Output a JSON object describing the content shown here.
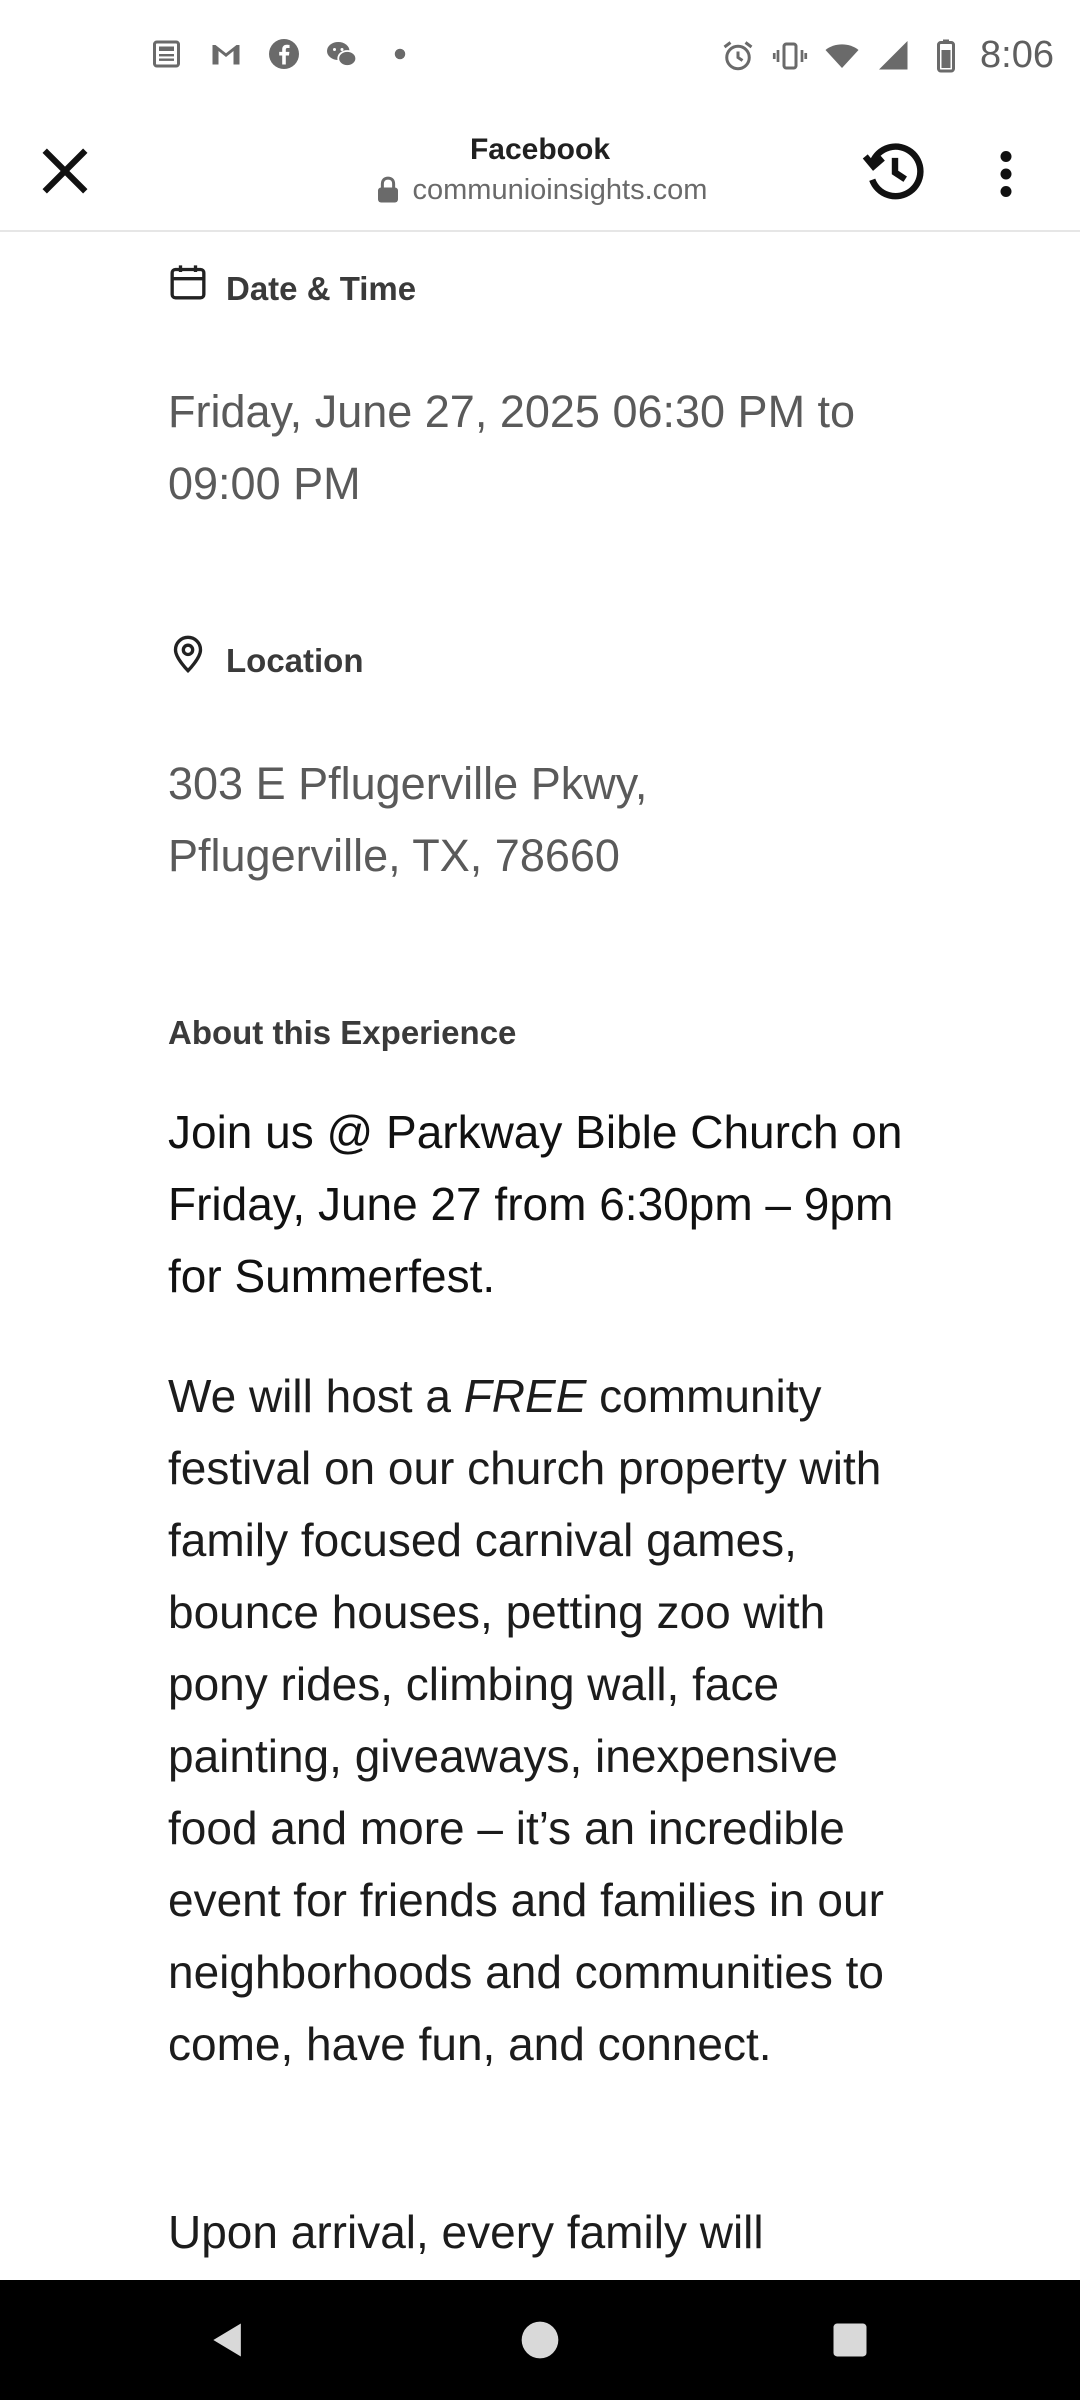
{
  "status_bar": {
    "time": "8:06",
    "left_icons": [
      "news-icon",
      "gmail-icon",
      "facebook-icon",
      "wechat-icon",
      "dot-icon"
    ],
    "right_icons": [
      "alarm-icon",
      "vibrate-icon",
      "wifi-icon",
      "signal-icon",
      "battery-icon"
    ]
  },
  "header": {
    "title": "Facebook",
    "url": "communioinsights.com"
  },
  "event": {
    "date_label": "Date & Time",
    "date_line1": "Friday, June 27, 2025 06:30 PM to",
    "date_line2": "09:00 PM",
    "location_label": "Location",
    "location_line1": "303 E Pflugerville Pkwy,",
    "location_line2": "Pflugerville, TX, 78660",
    "about_label": "About this Experience",
    "intro": "Join us @ Parkway Bible Church on Friday, June 27 from 6:30pm – 9pm for Summerfest.",
    "body_prefix": "We will host a ",
    "body_em": "FREE",
    "body_suffix": " community festival on our church property with family focused carnival games, bounce houses, petting zoo with pony rides, climbing wall, face painting, giveaways, inexpensive food and more – it’s an incredible event for friends and families in our neighborhoods and communities to come, have fun, and connect.",
    "body2": "Upon arrival, every family will"
  }
}
